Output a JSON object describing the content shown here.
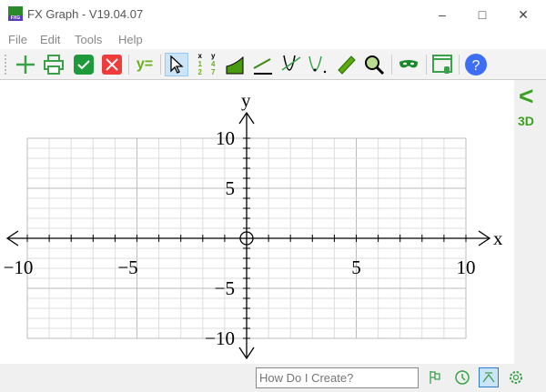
{
  "window": {
    "title": "FX Graph - V19.04.07",
    "icon_text": "FXG"
  },
  "menu": [
    "File",
    "Edit",
    "Tools",
    "Help"
  ],
  "toolbar": {
    "y_equals": "y=",
    "table_x": "x",
    "table_y": "y",
    "table_vals": [
      "1",
      "4",
      "2",
      "7"
    ]
  },
  "side": {
    "collapse": "<",
    "three_d": "3D"
  },
  "status": {
    "search_placeholder": "How Do I Create?"
  },
  "graph": {
    "x_label": "x",
    "y_label": "y",
    "x_range": [
      -10,
      10
    ],
    "y_range": [
      -10,
      10
    ],
    "x_ticks": [
      {
        "v": -10,
        "t": "−10"
      },
      {
        "v": -5,
        "t": "−5"
      },
      {
        "v": 5,
        "t": "5"
      },
      {
        "v": 10,
        "t": "10"
      }
    ],
    "y_ticks": [
      {
        "v": 10,
        "t": "10"
      },
      {
        "v": 5,
        "t": "5"
      },
      {
        "v": -5,
        "t": "−5"
      },
      {
        "v": -10,
        "t": "−10"
      }
    ]
  }
}
